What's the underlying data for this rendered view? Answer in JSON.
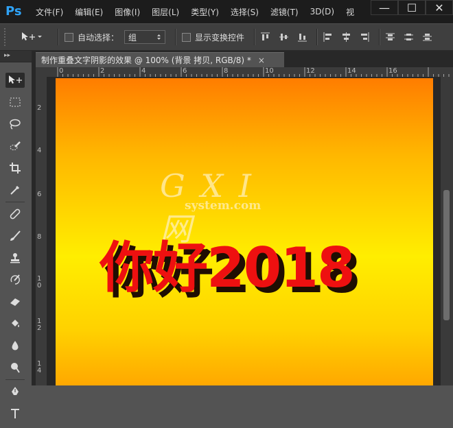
{
  "menubar": {
    "logo": "Ps",
    "items": [
      "文件(F)",
      "编辑(E)",
      "图像(I)",
      "图层(L)",
      "类型(Y)",
      "选择(S)",
      "滤镜(T)",
      "3D(D)",
      "视"
    ]
  },
  "window_controls": {
    "minimize": "—",
    "maximize": "☐",
    "close": "✕"
  },
  "options": {
    "auto_select_label": "自动选择：",
    "auto_select_value": "组",
    "show_transform_label": "显示变换控件"
  },
  "toolpanel": {
    "collapse": "▸▸"
  },
  "document": {
    "tab_title": "制作重叠文字阴影的效果 @ 100% (背景 拷贝, RGB/8) *",
    "tab_close": "×"
  },
  "rulers": {
    "h_ticks": [
      "0",
      "2",
      "4",
      "6",
      "8",
      "10",
      "12",
      "14",
      "16"
    ],
    "v_ticks": [
      "2",
      "4",
      "6",
      "8",
      "1 0",
      "1 2",
      "1 4"
    ]
  },
  "canvas": {
    "text": "你好2018",
    "watermark_main": "G X I 网",
    "watermark_sub": "system.com",
    "text_color": "#ee1010",
    "shadow_color": "#1f0e02"
  },
  "tools": [
    "move-tool",
    "marquee-tool",
    "lasso-tool",
    "quick-select-tool",
    "crop-tool",
    "eyedropper-tool",
    "healing-brush-tool",
    "brush-tool",
    "clone-stamp-tool",
    "history-brush-tool",
    "eraser-tool",
    "paint-bucket-tool",
    "blur-tool",
    "dodge-tool",
    "pen-tool",
    "type-tool"
  ]
}
